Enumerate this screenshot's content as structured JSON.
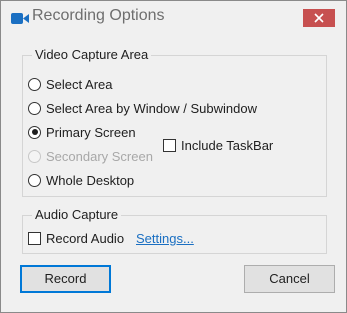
{
  "window": {
    "title": "Recording Options",
    "close_glyph": "✕"
  },
  "video_capture": {
    "legend": "Video Capture Area",
    "options": [
      {
        "label": "Select Area",
        "selected": false,
        "disabled": false
      },
      {
        "label": "Select Area by Window / Subwindow",
        "selected": false,
        "disabled": false
      },
      {
        "label": "Primary Screen",
        "selected": true,
        "disabled": false
      },
      {
        "label": "Secondary Screen",
        "selected": false,
        "disabled": true
      },
      {
        "label": "Whole Desktop",
        "selected": false,
        "disabled": false
      }
    ],
    "include_taskbar": {
      "label": "Include TaskBar",
      "checked": false
    }
  },
  "audio_capture": {
    "legend": "Audio Capture",
    "record_audio": {
      "label": "Record Audio",
      "checked": false
    },
    "settings_link": "Settings..."
  },
  "buttons": {
    "record": "Record",
    "cancel": "Cancel"
  },
  "icons": {
    "app": "video-camera-icon",
    "close": "close-icon"
  },
  "colors": {
    "app_icon": "#1a6fc2",
    "close_button": "#c75050",
    "link": "#1a6fc2",
    "default_button_border": "#0078d7"
  }
}
